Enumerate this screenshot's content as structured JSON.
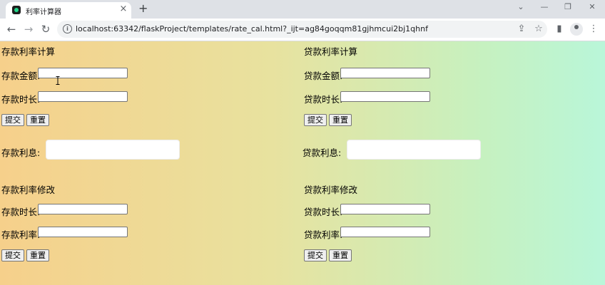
{
  "browser": {
    "tab_title": "利率计算器",
    "tab_close": "×",
    "new_tab": "+",
    "url": "localhost:63342/flaskProject/templates/rate_cal.html?_ijt=ag84goqqm81gjhmcui2bj1qhnf",
    "icons": {
      "back": "←",
      "forward": "→",
      "reload": "↻",
      "info": "i",
      "share": "⇪",
      "star": "☆",
      "sidebar": "▮",
      "menu": "⋮",
      "minimize": "—",
      "maximize": "❐",
      "close": "✕",
      "tab_search": "⌄"
    }
  },
  "deposit": {
    "title": "存款利率计算",
    "amount_label": "存款金额:",
    "amount_value": "",
    "duration_label": "存款时长:",
    "duration_value": "",
    "submit": "提交",
    "reset": "重置",
    "result_label": "存款利息:",
    "result_value": ""
  },
  "loan": {
    "title": "贷款利率计算",
    "amount_label": "贷款金额:",
    "amount_value": "",
    "duration_label": "贷款时长:",
    "duration_value": "",
    "submit": "提交",
    "reset": "重置",
    "result_label": "贷款利息:",
    "result_value": ""
  },
  "deposit_modify": {
    "title": "存款利率修改",
    "duration_label": "存款时长:",
    "duration_value": "",
    "rate_label": "存款利率:",
    "rate_value": "",
    "submit": "提交",
    "reset": "重置"
  },
  "loan_modify": {
    "title": "贷款利率修改",
    "duration_label": "贷款时长:",
    "duration_value": "",
    "rate_label": "贷款利率:",
    "rate_value": "",
    "submit": "提交",
    "reset": "重置"
  }
}
